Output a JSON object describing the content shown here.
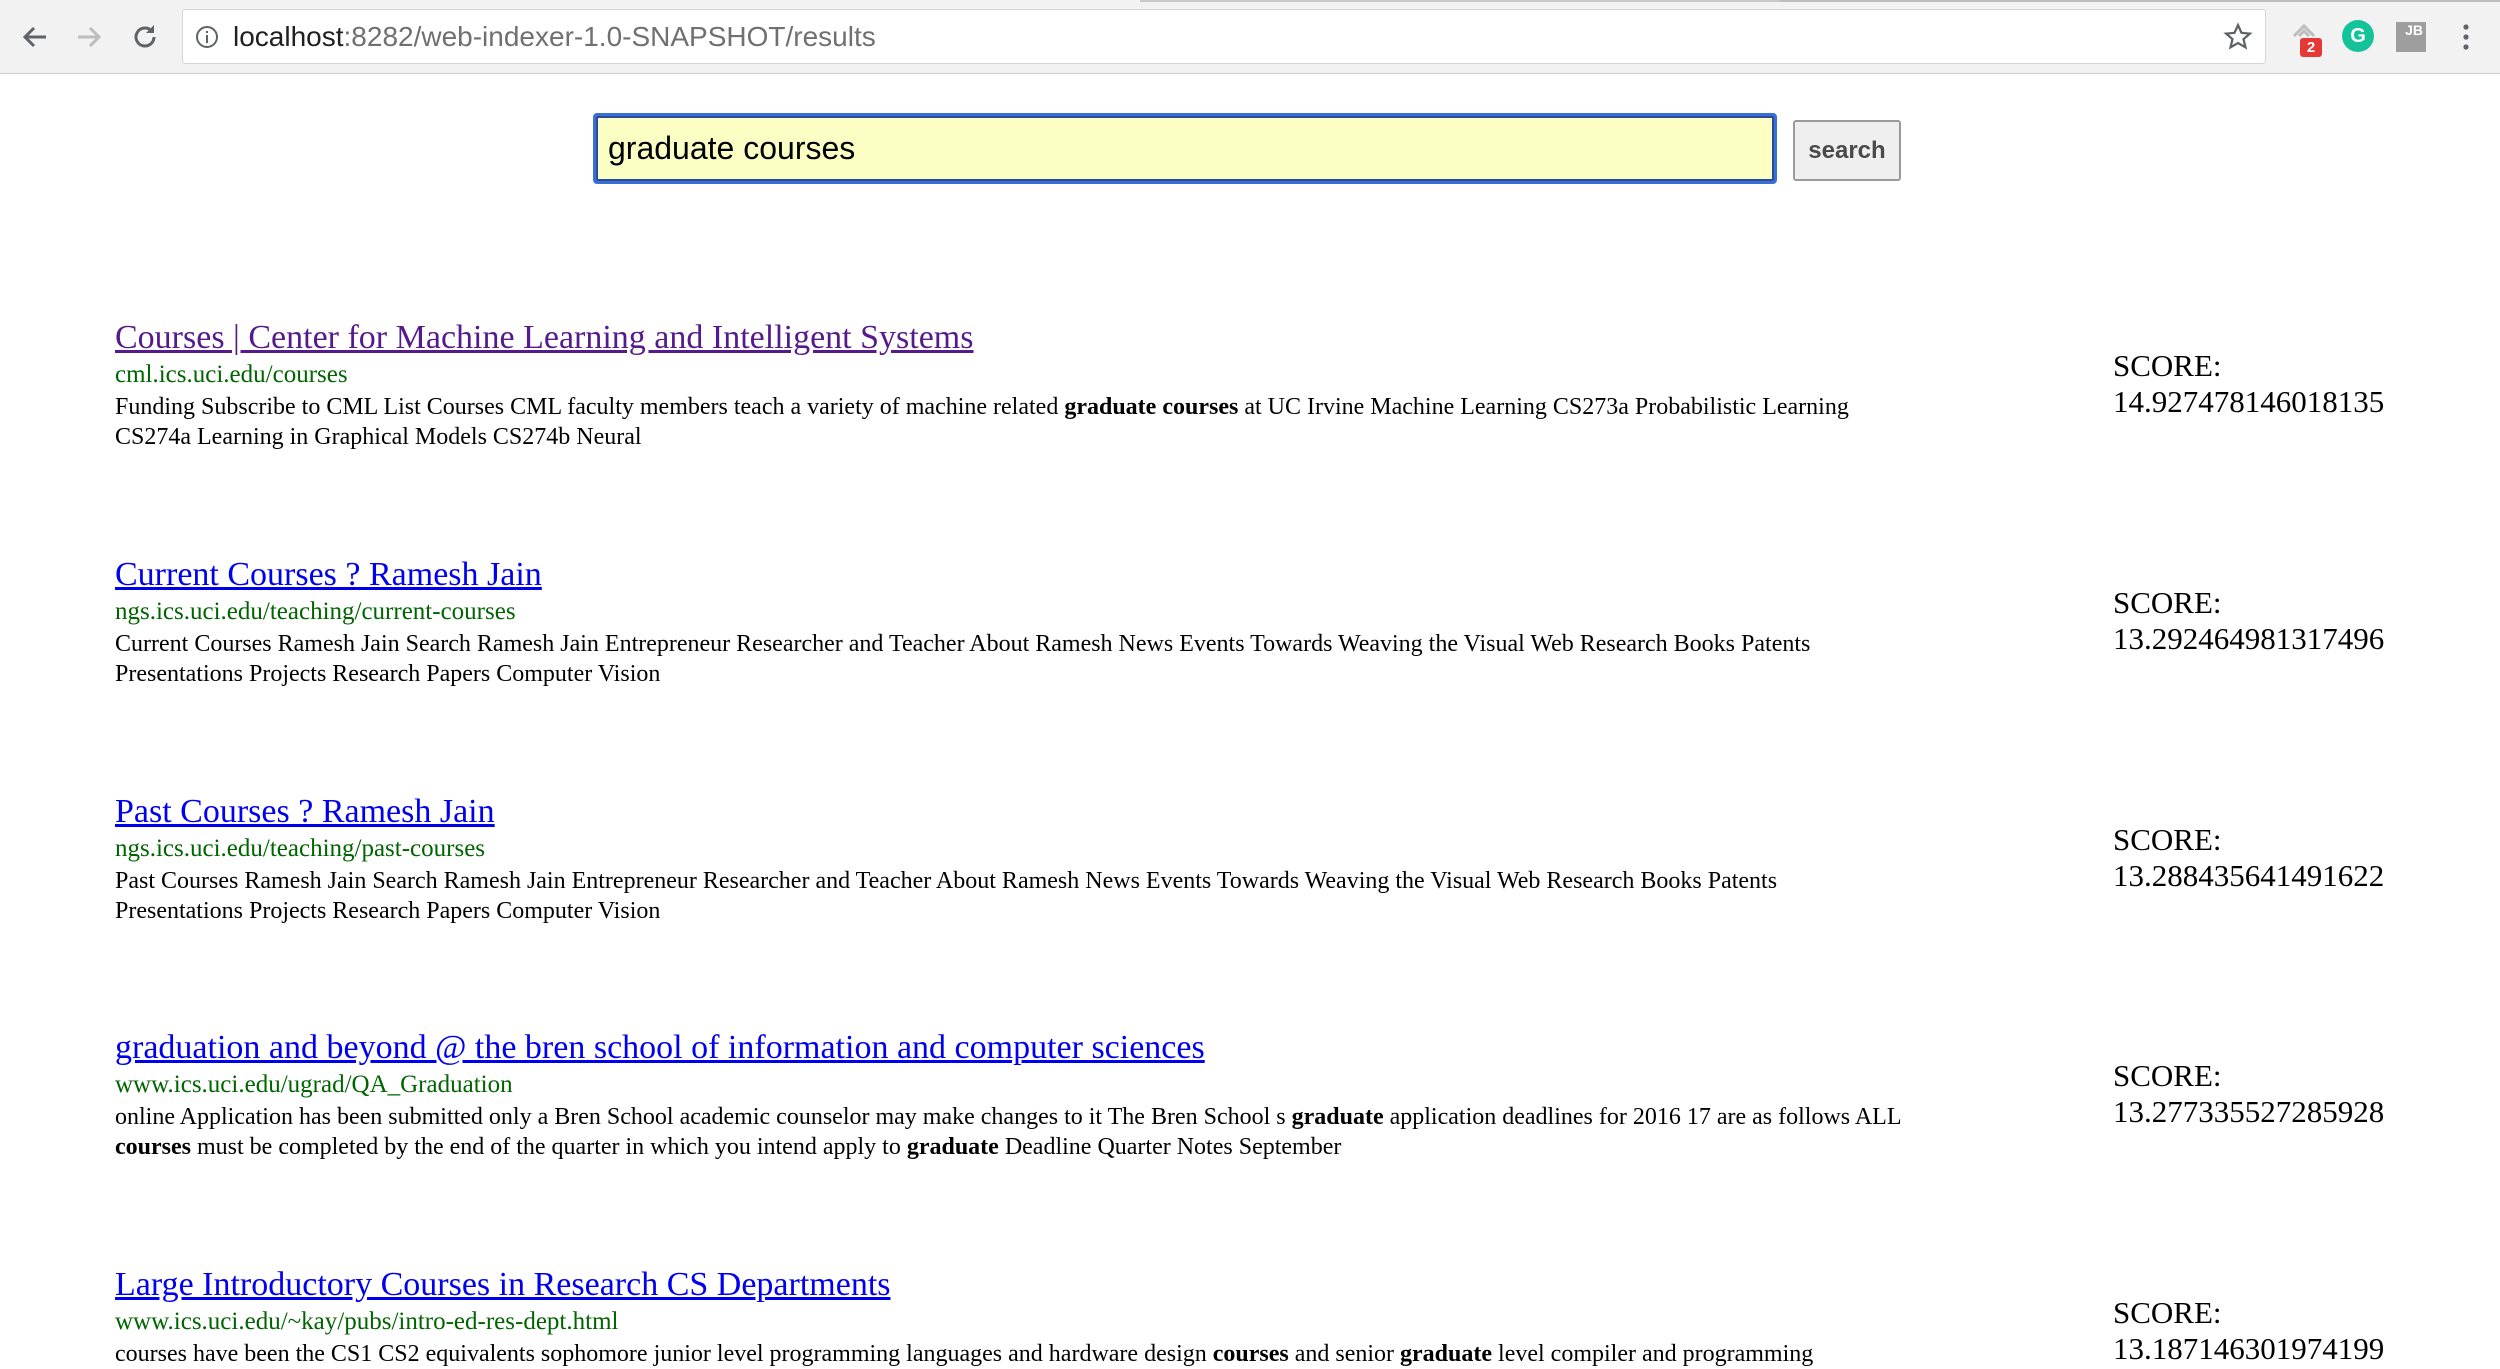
{
  "browser": {
    "url_host": "localhost",
    "url_path": ":8282/web-indexer-1.0-SNAPSHOT/results",
    "extension_badge": "2",
    "extension_g_label": "G",
    "extension_jb_label": "JB",
    "icons": [
      "back-arrow-icon",
      "forward-arrow-icon",
      "reload-icon",
      "info-icon",
      "star-icon",
      "extension-icon",
      "grammarly-icon",
      "jetbrains-icon",
      "menu-dots-icon"
    ]
  },
  "search": {
    "value": "graduate courses",
    "button_label": "search"
  },
  "score_label": "SCORE:",
  "results": [
    {
      "title": "Courses | Center for Machine Learning and Intelligent Systems",
      "url": "cml.ics.uci.edu/courses",
      "snippet": [
        {
          "t": "Funding Subscribe to CML List Courses CML faculty members teach a variety of machine related ",
          "b": false
        },
        {
          "t": "graduate courses",
          "b": true
        },
        {
          "t": " at UC Irvine Machine Learning CS273a Probabilistic Learning",
          "b": false
        },
        {
          "br": true
        },
        {
          "t": "CS274a Learning in Graphical Models CS274b Neural",
          "b": false
        }
      ],
      "score": "14.927478146018135",
      "visited": true
    },
    {
      "title": "Current Courses ? Ramesh Jain",
      "url": "ngs.ics.uci.edu/teaching/current-courses",
      "snippet": [
        {
          "t": "Current Courses Ramesh Jain Search Ramesh Jain Entrepreneur Researcher and Teacher About Ramesh News Events Towards Weaving the Visual Web Research Books Patents",
          "b": false
        },
        {
          "br": true
        },
        {
          "t": "Presentations Projects Research Papers Computer Vision",
          "b": false
        }
      ],
      "score": "13.292464981317496",
      "visited": false
    },
    {
      "title": "Past Courses ? Ramesh Jain",
      "url": "ngs.ics.uci.edu/teaching/past-courses",
      "snippet": [
        {
          "t": "Past Courses Ramesh Jain Search Ramesh Jain Entrepreneur Researcher and Teacher About Ramesh News Events Towards Weaving the Visual Web Research Books Patents",
          "b": false
        },
        {
          "br": true
        },
        {
          "t": "Presentations Projects Research Papers Computer Vision",
          "b": false
        }
      ],
      "score": "13.288435641491622",
      "visited": false
    },
    {
      "title": "graduation and beyond @ the bren school of information and computer sciences",
      "url": "www.ics.uci.edu/ugrad/QA_Graduation",
      "snippet": [
        {
          "t": "online Application has been submitted only a Bren School academic counselor may make changes to it The Bren School s ",
          "b": false
        },
        {
          "t": "graduate",
          "b": true
        },
        {
          "t": " application deadlines for 2016 17 are as follows ALL",
          "b": false
        },
        {
          "br": true
        },
        {
          "t": "courses",
          "b": true
        },
        {
          "t": " must be completed by the end of the quarter in which you intend apply to ",
          "b": false
        },
        {
          "t": "graduate",
          "b": true
        },
        {
          "t": " Deadline Quarter Notes September",
          "b": false
        }
      ],
      "score": "13.277335527285928",
      "visited": false
    },
    {
      "title": "Large Introductory Courses in Research CS Departments",
      "url": "www.ics.uci.edu/~kay/pubs/intro-ed-res-dept.html",
      "snippet": [
        {
          "t": "courses have been the CS1 CS2 equivalents sophomore junior level programming languages and hardware design ",
          "b": false
        },
        {
          "t": "courses",
          "b": true
        },
        {
          "t": " and senior ",
          "b": false
        },
        {
          "t": "graduate",
          "b": true
        },
        {
          "t": " level compiler and programming",
          "b": false
        }
      ],
      "score": "13.187146301974199",
      "visited": false
    }
  ]
}
